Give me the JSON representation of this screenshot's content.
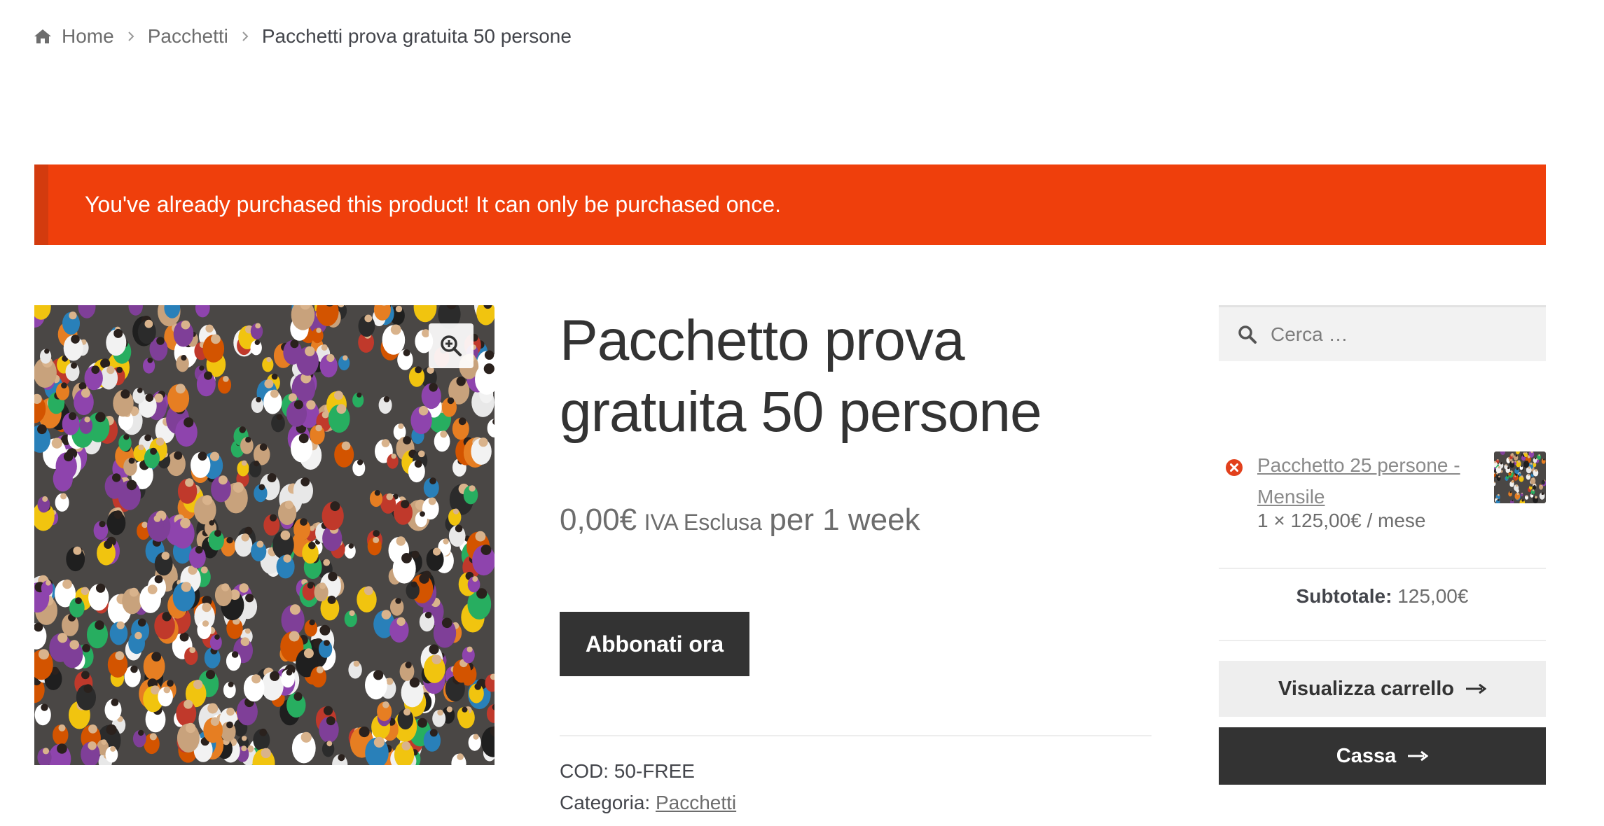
{
  "breadcrumb": {
    "home_icon": "home-icon",
    "items": [
      "Home",
      "Pacchetti"
    ],
    "current": "Pacchetti prova gratuita 50 persone"
  },
  "notice": {
    "text": "You've already purchased this product! It can only be purchased once.",
    "color": "#ef3f0c"
  },
  "product": {
    "image_alt": "crowd-photo",
    "zoom_icon": "zoom-in-icon",
    "title": "Pacchetto prova gratuita 50 persone",
    "price": "0,00€",
    "tax_note": "IVA Esclusa",
    "period": "per 1 week",
    "subscribe_label": "Abbonati ora",
    "sku_label": "COD:",
    "sku": "50-FREE",
    "category_label": "Categoria:",
    "category": "Pacchetti"
  },
  "sidebar": {
    "search_placeholder": "Cerca …",
    "cart": {
      "item_name": "Pacchetto 25 persone - Mensile",
      "item_qty": "1 × 125,00€ / mese",
      "subtotal_label": "Subtotale:",
      "subtotal_value": "125,00€",
      "view_cart_label": "Visualizza carrello",
      "checkout_label": "Cassa"
    }
  }
}
